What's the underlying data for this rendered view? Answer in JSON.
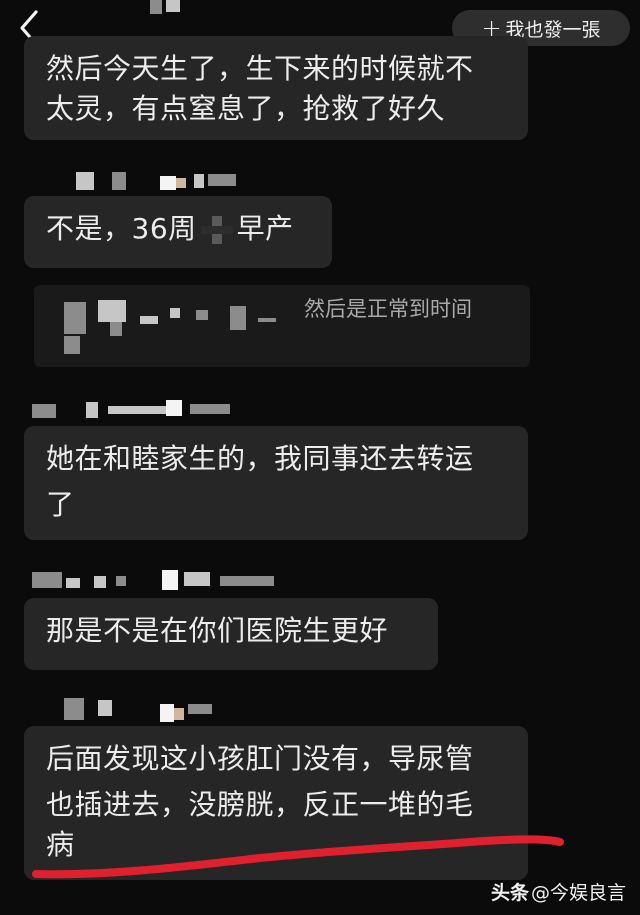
{
  "header": {
    "back_icon": "chevron-left-icon",
    "action_button": {
      "icon": "plus-icon",
      "icon_glyph": "+",
      "label": "我也發一張"
    }
  },
  "messages": [
    {
      "id": "m1",
      "lines": [
        "然后今天生了，生下来的时候就不",
        "太灵，有点窒息了，抢救了好久"
      ]
    },
    {
      "id": "m2",
      "text_before": "不是，36周",
      "text_after": "早产"
    },
    {
      "id": "m3",
      "quote_text": "然后是正常到时间"
    },
    {
      "id": "m4",
      "lines": [
        "她在和睦家生的，我同事还去转运",
        "了"
      ]
    },
    {
      "id": "m5",
      "lines": [
        "那是不是在你们医院生更好"
      ]
    },
    {
      "id": "m6",
      "lines": [
        "后面发现这小孩肛门没有，导尿管",
        "也插进去，没膀胱，反正一堆的毛",
        "病"
      ]
    }
  ],
  "annotation": {
    "color": "#e0202e"
  },
  "watermark": {
    "logo": "头条",
    "author": "@今娱良言"
  }
}
